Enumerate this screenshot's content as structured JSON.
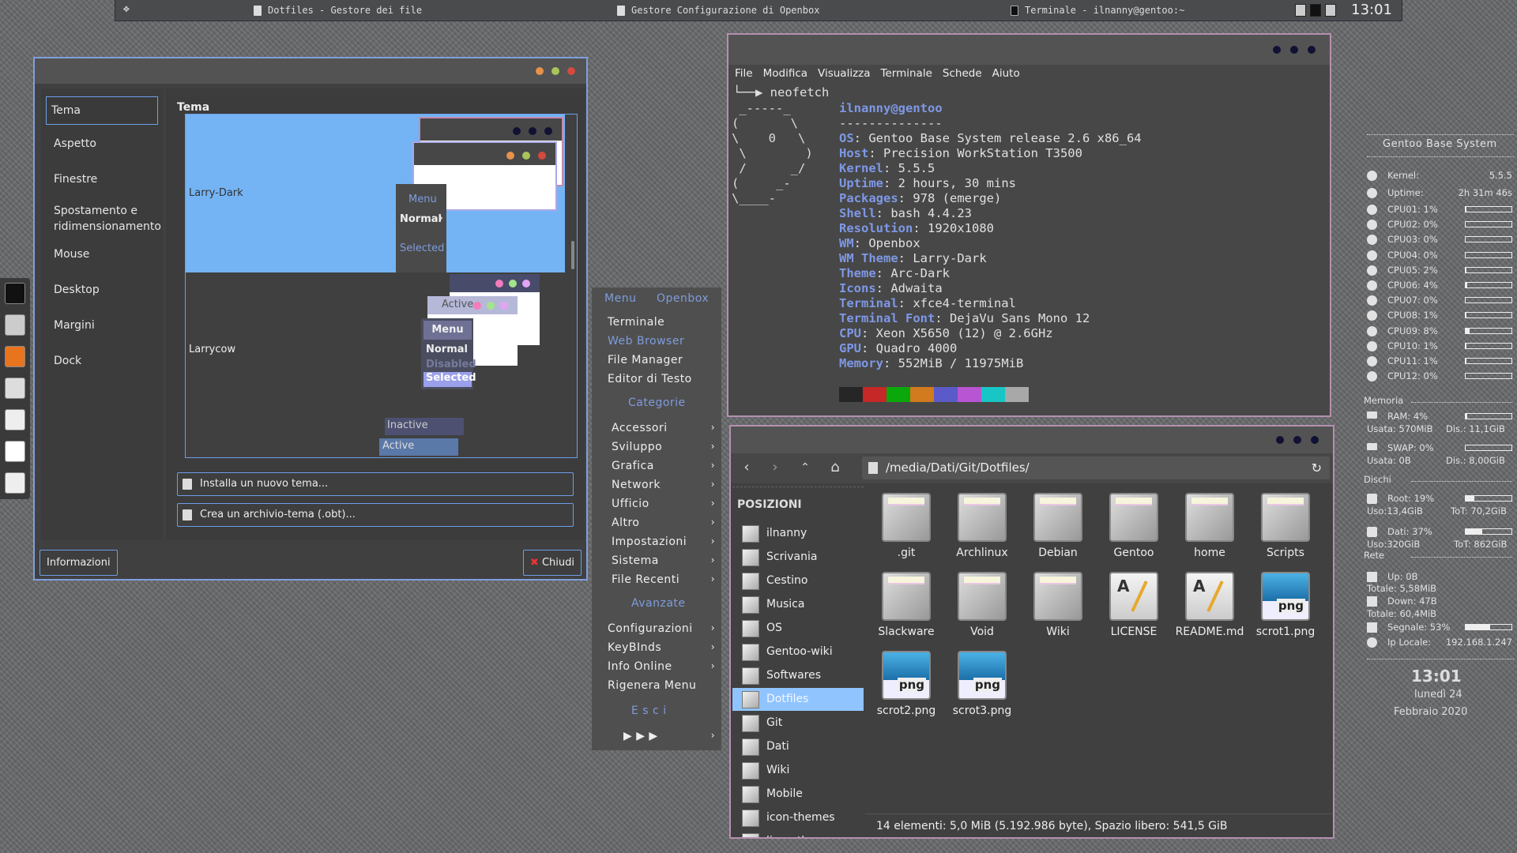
{
  "taskbar": {
    "tasks": [
      "Dotfiles - Gestore dei file",
      "Gestore Configurazione di Openbox",
      "Terminale - ilnanny@gentoo:~"
    ],
    "clock": "13:01"
  },
  "obconf": {
    "sidebar": [
      "Tema",
      "Aspetto",
      "Finestre",
      "Spostamento e ridimensionamento",
      "Mouse",
      "Desktop",
      "Margini",
      "Dock"
    ],
    "section_title": "Tema",
    "themes": [
      {
        "name": "Larry-Dark",
        "preview": {
          "menu": "Menu",
          "normal": "Normal",
          "selected": "Selected"
        }
      },
      {
        "name": "Larrycow",
        "preview": {
          "active": "Active",
          "menu": "Menu",
          "normal": "Normal",
          "disabled": "Disabled",
          "selected": "Selected",
          "inactive": "Inactive",
          "active2": "Active"
        }
      }
    ],
    "install_button": "Installa un nuovo tema...",
    "create_button": "Crea un archivio-tema (.obt)...",
    "about_button": "Informazioni",
    "close_button": "Chiudi",
    "accent": "#6e9ee8",
    "selected_bg": "#74b4f4"
  },
  "dock": {
    "icons": [
      "terminal-icon",
      "file-cabinet-icon",
      "firefox-icon",
      "settings-mixer-icon",
      "gentoo-installer-icon",
      "inkscape-icon",
      "image-viewer-icon"
    ]
  },
  "menu": {
    "title": [
      "Menu",
      "Openbox"
    ],
    "top_items": [
      "Terminale",
      "Web Browser",
      "File Manager",
      "Editor di Testo"
    ],
    "cat_header": "Categorie",
    "categories": [
      "Accessori",
      "Sviluppo",
      "Grafica",
      "Network",
      "Ufficio",
      "Altro",
      "Impostazioni",
      "Sistema",
      "File  Recenti"
    ],
    "adv_header": "Avanzate",
    "advanced": [
      {
        "label": "Configurazioni",
        "sub": true
      },
      {
        "label": "KeyBInds",
        "sub": true
      },
      {
        "label": "Info   Online",
        "sub": true
      },
      {
        "label": "Rigenera  Menu",
        "sub": false
      }
    ],
    "exit_header": "E  s  c  i",
    "exit_row": "▶    ▶    ▶",
    "highlight_color": "#7e9cdc"
  },
  "terminal": {
    "menu": [
      "File",
      "Modifica",
      "Visualizza",
      "Terminale",
      "Schede",
      "Aiuto"
    ],
    "prompt": "└──▶ neofetch",
    "ascii": [
      " _-----_",
      "(       \\",
      "\\    0   \\",
      " \\        )",
      " /      _/",
      "(     _-",
      "\\____-"
    ],
    "user": "ilnanny@gentoo",
    "separator": "--------------",
    "info": [
      {
        "k": "OS",
        "v": "Gentoo Base System release 2.6 x86_64"
      },
      {
        "k": "Host",
        "v": "Precision WorkStation T3500"
      },
      {
        "k": "Kernel",
        "v": "5.5.5"
      },
      {
        "k": "Uptime",
        "v": "2 hours, 30 mins"
      },
      {
        "k": "Packages",
        "v": "978 (emerge)"
      },
      {
        "k": "Shell",
        "v": "bash 4.4.23"
      },
      {
        "k": "Resolution",
        "v": "1920x1080"
      },
      {
        "k": "WM",
        "v": "Openbox"
      },
      {
        "k": "WM Theme",
        "v": "Larry-Dark"
      },
      {
        "k": "Theme",
        "v": "Arc-Dark"
      },
      {
        "k": "Icons",
        "v": "Adwaita"
      },
      {
        "k": "Terminal",
        "v": "xfce4-terminal"
      },
      {
        "k": "Terminal Font",
        "v": "DejaVu Sans Mono 12"
      },
      {
        "k": "CPU",
        "v": "Xeon X5650 (12) @ 2.6GHz"
      },
      {
        "k": "GPU",
        "v": "Quadro 4000"
      },
      {
        "k": "Memory",
        "v": "552MiB / 11975MiB"
      }
    ],
    "palette": [
      "#262626",
      "#c62727",
      "#0aa80a",
      "#d27a1e",
      "#5a5ac8",
      "#b855d2",
      "#19c6c6",
      "#a8a8a8"
    ]
  },
  "filemanager": {
    "path": "/media/Dati/Git/Dotfiles/",
    "places_header": "POSIZIONI",
    "places": [
      "ilnanny",
      "Scrivania",
      "Cestino",
      "Musica",
      "OS",
      "Gentoo-wiki",
      "Softwares",
      "Dotfiles",
      "Git",
      "Dati",
      "Wiki",
      "Mobile",
      "icon-themes",
      "linux-themes"
    ],
    "selected_place": "Dotfiles",
    "files": [
      {
        "name": ".git",
        "type": "folder"
      },
      {
        "name": "Archlinux",
        "type": "folder"
      },
      {
        "name": "Debian",
        "type": "folder"
      },
      {
        "name": "Gentoo",
        "type": "folder"
      },
      {
        "name": "home",
        "type": "folder"
      },
      {
        "name": "Scripts",
        "type": "folder"
      },
      {
        "name": "Slackware",
        "type": "folder"
      },
      {
        "name": "Void",
        "type": "folder"
      },
      {
        "name": "Wiki",
        "type": "folder"
      },
      {
        "name": "LICENSE",
        "type": "text"
      },
      {
        "name": "README.md",
        "type": "text"
      },
      {
        "name": "scrot1.png",
        "type": "png"
      },
      {
        "name": "scrot2.png",
        "type": "png"
      },
      {
        "name": "scrot3.png",
        "type": "png"
      }
    ],
    "png_badge": "png",
    "status": "14 elementi: 5,0 MiB (5.192.986 byte), Spazio libero: 541,5 GiB"
  },
  "conky": {
    "title": "Gentoo Base System",
    "kernel": {
      "label": "Kernel:",
      "value": "5.5.5"
    },
    "uptime": {
      "label": "Uptime:",
      "value": "2h 31m 46s"
    },
    "cpus": [
      {
        "label": "CPU01: 1%",
        "pct": 1
      },
      {
        "label": "CPU02: 0%",
        "pct": 0
      },
      {
        "label": "CPU03: 0%",
        "pct": 0
      },
      {
        "label": "CPU04: 0%",
        "pct": 0
      },
      {
        "label": "CPU05: 2%",
        "pct": 2
      },
      {
        "label": "CPU06: 4%",
        "pct": 4
      },
      {
        "label": "CPU07: 0%",
        "pct": 0
      },
      {
        "label": "CPU08: 1%",
        "pct": 1
      },
      {
        "label": "CPU09: 8%",
        "pct": 8
      },
      {
        "label": "CPU10: 1%",
        "pct": 1
      },
      {
        "label": "CPU11: 1%",
        "pct": 1
      },
      {
        "label": "CPU12: 0%",
        "pct": 0
      }
    ],
    "memory_header": "Memoria",
    "ram": {
      "label": "RAM: 4%",
      "pct": 4,
      "used": "Usata: 570MiB",
      "free": "Dis.: 11,1GiB"
    },
    "swap": {
      "label": "SWAP: 0%",
      "pct": 0,
      "used": "Usata: 0B",
      "free": "Dis.: 8,00GiB"
    },
    "disks_header": "Dischi",
    "root": {
      "label": "Root: 19%",
      "pct": 19,
      "used": "Uso:13,4GiB",
      "total": "ToT: 70,2GiB"
    },
    "dati": {
      "label": "Dati: 37%",
      "pct": 37,
      "used": "Uso:320GiB",
      "total": "ToT: 862GiB"
    },
    "net_header": "Rete",
    "up": {
      "label": "Up: 0B",
      "total": "Totale: 5,58MiB"
    },
    "down": {
      "label": "Down: 47B",
      "total": "Totale: 60,4MiB"
    },
    "signal": {
      "label": "Segnale: 53%",
      "pct": 53
    },
    "ip": {
      "label": "Ip Locale:",
      "value": "192.168.1.247"
    },
    "time": "13:01",
    "day": "lunedì 24",
    "date": "Febbraio 2020"
  }
}
